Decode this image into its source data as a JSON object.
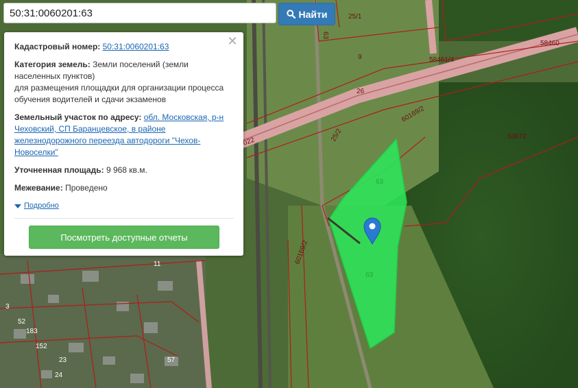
{
  "search": {
    "value": "50:31:0060201:63",
    "button_label": "Найти"
  },
  "popup": {
    "cadastral_label": "Кадастровый номер:",
    "cadastral_value": "50:31:0060201:63",
    "category_label": "Категория земель:",
    "category_value": "Земли поселений (земли населенных пунктов)",
    "purpose": "для размещения площадки для организации процесса обучения водителей и сдачи экзаменов",
    "address_label": "Земельный участок по адресу:",
    "address_value": "обл. Московская, р-н Чеховский, СП Баранцевское, в районе железнодорожного переезда автодороги \"Чехов-Новоселки\"",
    "area_label": "Уточненная площадь:",
    "area_value": "9 968 кв.м.",
    "survey_label": "Межевание:",
    "survey_value": "Проведено",
    "more_label": "Подробно",
    "reports_button": "Посмотреть доступные отчеты"
  },
  "map": {
    "labels": {
      "l1": "25/1",
      "l2": "63",
      "l3": "9",
      "l4": "58461/4",
      "l5": "58460",
      "l6": "26",
      "l7": "60169/2",
      "l8": "25/2",
      "l9": "53672",
      "l10": "022",
      "l11": "63",
      "l12": "60169/2",
      "l13": "63",
      "l14": "11",
      "l15": "3",
      "l16": "52",
      "l17": "183",
      "l18": "152",
      "l19": "23",
      "l20": "24",
      "l21": "57"
    },
    "parcel_color": "#2ee65a",
    "boundary_color": "#b01c1c"
  },
  "icons": {
    "search": "search-icon",
    "close": "close-icon",
    "marker": "map-marker-icon",
    "expand": "triangle-down-icon"
  }
}
